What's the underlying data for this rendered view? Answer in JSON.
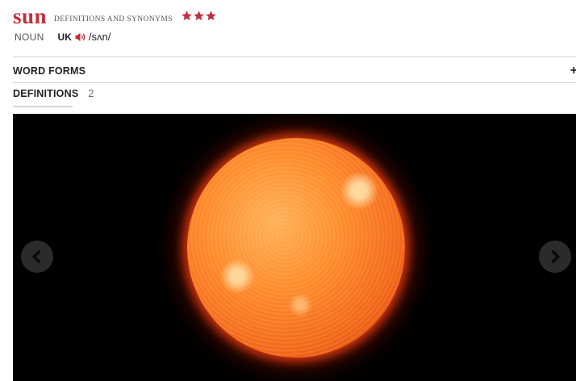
{
  "entry": {
    "headword": "sun",
    "subtitle": "DEFINITIONS AND SYNONYMS",
    "star_rating": 3,
    "star_color": "#c62d3a",
    "headword_color": "#c62d3a"
  },
  "pronunciation": {
    "part_of_speech": "NOUN",
    "region": "UK",
    "ipa": "/sʌn/",
    "audio_icon": "speaker-icon"
  },
  "sections": {
    "word_forms": {
      "label": "WORD FORMS",
      "toggle": "+"
    },
    "definitions": {
      "label": "DEFINITIONS",
      "count": "2"
    }
  },
  "gallery": {
    "image_subject": "sun",
    "prev_icon": "chevron-left-icon",
    "next_icon": "chevron-right-icon"
  }
}
